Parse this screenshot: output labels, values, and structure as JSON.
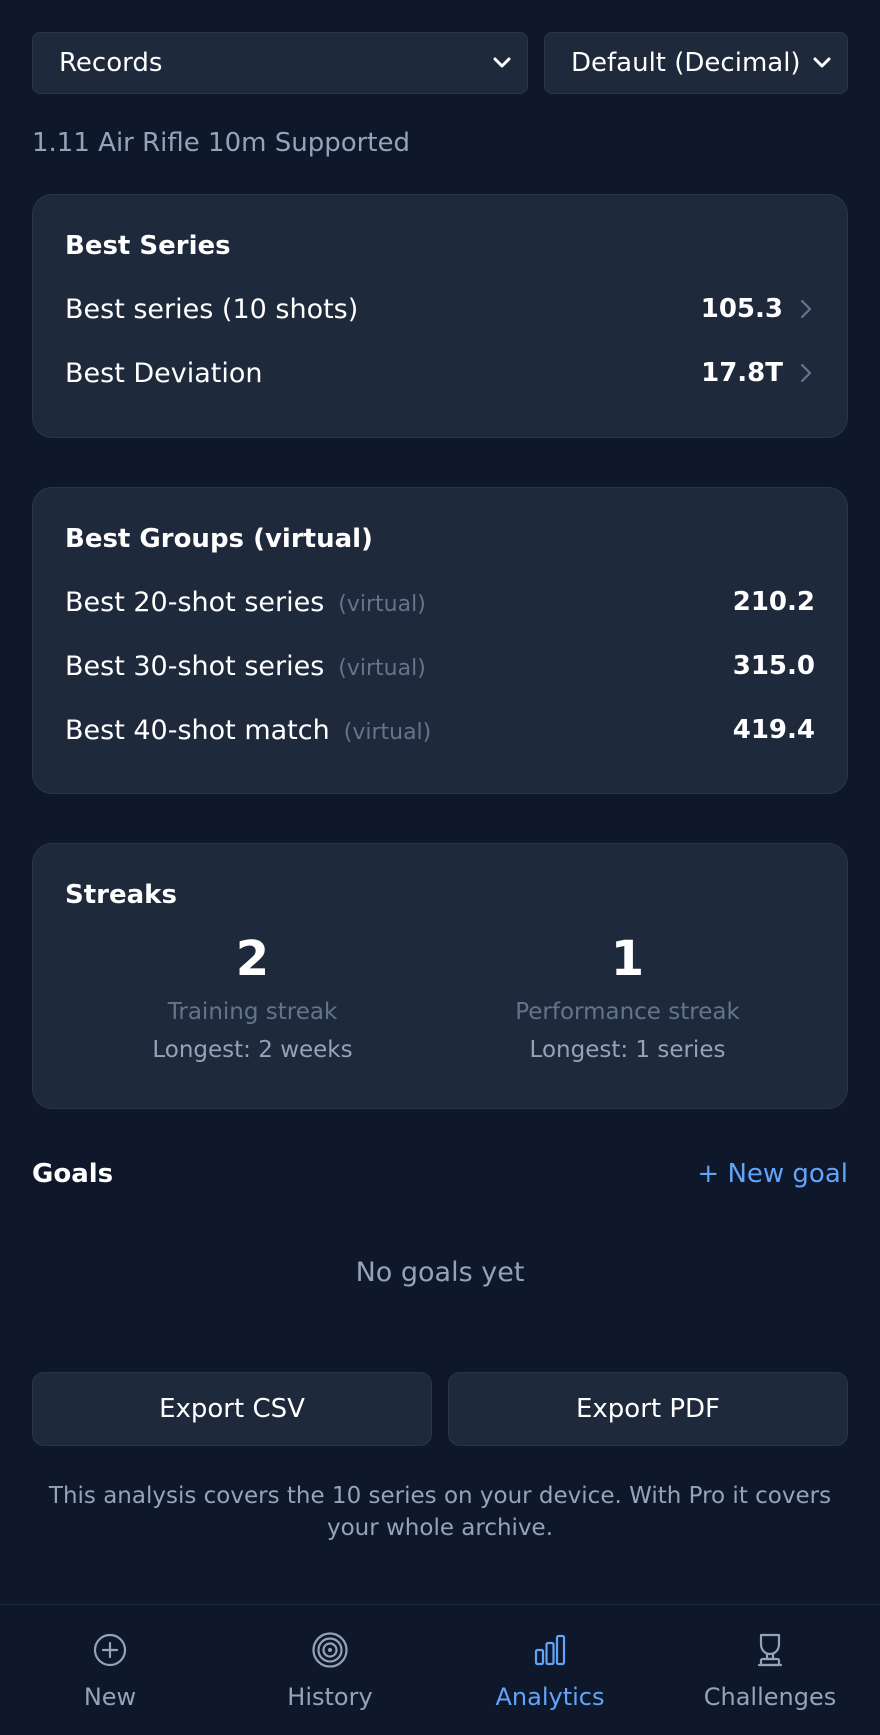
{
  "selectors": {
    "metric": "Records",
    "scoring": "Default (Decimal)"
  },
  "discipline": "1.11 Air Rifle 10m Supported",
  "best_series": {
    "title": "Best Series",
    "rows": [
      {
        "label": "Best series (10 shots)",
        "value": "105.3"
      },
      {
        "label": "Best Deviation",
        "value": "17.8T"
      }
    ]
  },
  "best_groups": {
    "title": "Best Groups (virtual)",
    "rows": [
      {
        "label": "Best 20-shot series",
        "tag": "(virtual)",
        "value": "210.2"
      },
      {
        "label": "Best 30-shot series",
        "tag": "(virtual)",
        "value": "315.0"
      },
      {
        "label": "Best 40-shot match",
        "tag": "(virtual)",
        "value": "419.4"
      }
    ]
  },
  "streaks": {
    "title": "Streaks",
    "items": [
      {
        "value": "2",
        "label": "Training streak",
        "longest": "Longest: 2 weeks"
      },
      {
        "value": "1",
        "label": "Performance streak",
        "longest": "Longest: 1 series"
      }
    ]
  },
  "goals": {
    "title": "Goals",
    "new_goal": "+ New goal",
    "empty": "No goals yet"
  },
  "exports": {
    "csv": "Export CSV",
    "pdf": "Export PDF"
  },
  "footnote": "This analysis covers the 10 series on your device. With Pro it covers your whole archive.",
  "tabs": [
    {
      "label": "New",
      "icon": "plus-circle-icon"
    },
    {
      "label": "History",
      "icon": "target-icon"
    },
    {
      "label": "Analytics",
      "icon": "bar-chart-icon",
      "active": true
    },
    {
      "label": "Challenges",
      "icon": "trophy-icon"
    }
  ],
  "colors": {
    "background": "#0f172a",
    "card": "#1e293b",
    "accent": "#60a5fa",
    "muted": "#94a3b8"
  }
}
